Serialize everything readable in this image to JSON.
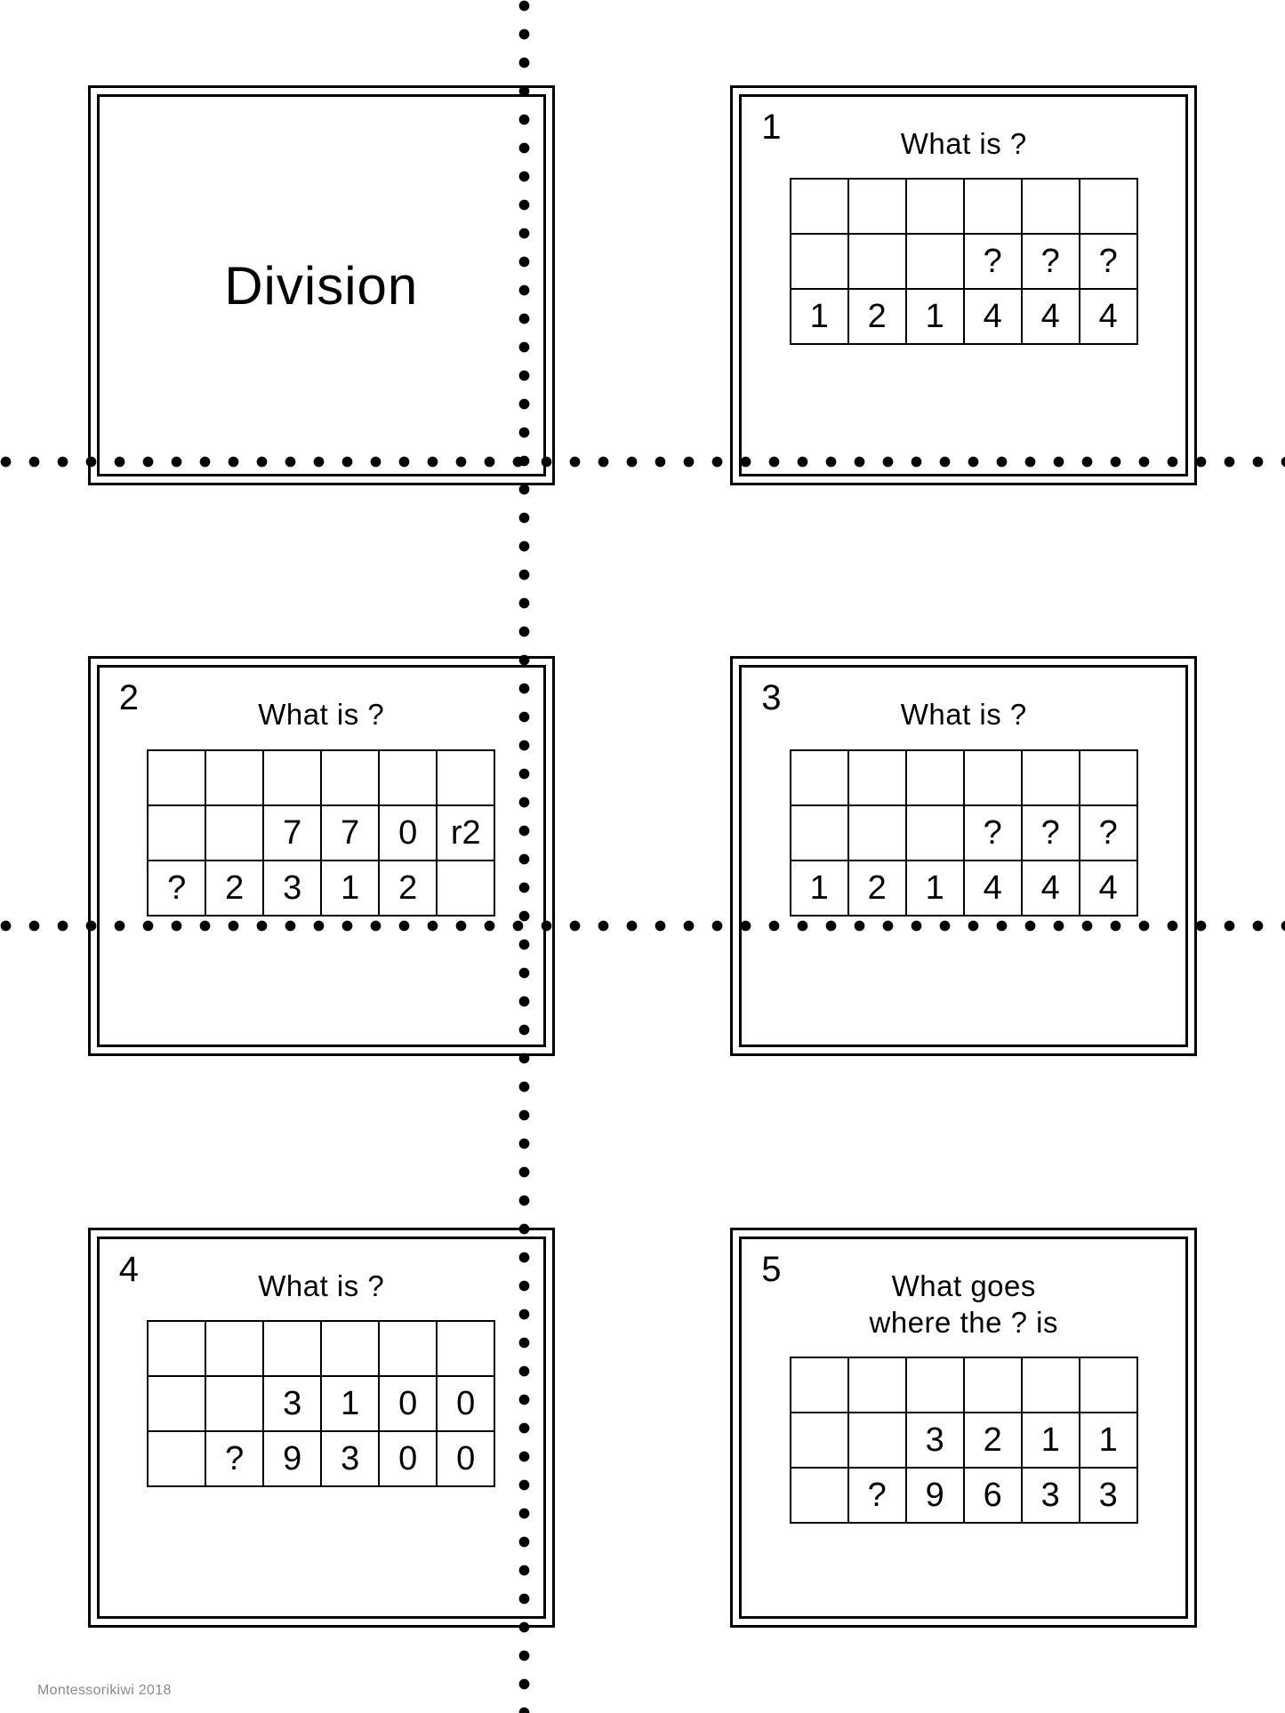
{
  "deck": {
    "title": "Division",
    "credit": "Montessorikiwi 2018"
  },
  "colors": {
    "units": "#1a7a1a",
    "tens": "#1a1aa8",
    "hundreds": "#d01414",
    "thousands": "#1a7a1a",
    "ink": "#000000",
    "credit": "#8a8a8a"
  },
  "prompts": {
    "what_is": "What is ?",
    "what_goes": "What goes\nwhere the ? is"
  },
  "cards": [
    {
      "number": "1",
      "prompt": "What is ?",
      "rows": [
        [
          {
            "text": "",
            "color": "black"
          },
          {
            "text": "",
            "color": "black"
          },
          {
            "text": "",
            "color": "black"
          },
          {
            "text": "",
            "color": "black"
          },
          {
            "text": "",
            "color": "black"
          },
          {
            "text": "",
            "color": "black"
          }
        ],
        [
          {
            "text": "",
            "color": "black"
          },
          {
            "text": "",
            "color": "black"
          },
          {
            "text": "",
            "color": "black"
          },
          {
            "text": "?",
            "color": "red"
          },
          {
            "text": "?",
            "color": "blue"
          },
          {
            "text": "?",
            "color": "green"
          }
        ],
        [
          {
            "text": "1",
            "color": "blue"
          },
          {
            "text": "2",
            "color": "green"
          },
          {
            "text": "1",
            "color": "green"
          },
          {
            "text": "4",
            "color": "red"
          },
          {
            "text": "4",
            "color": "blue"
          },
          {
            "text": "4",
            "color": "green"
          }
        ]
      ],
      "bracket": {
        "col": 2,
        "row": 2
      }
    },
    {
      "number": "2",
      "prompt": "What is ?",
      "rows": [
        [
          {
            "text": "",
            "color": "black"
          },
          {
            "text": "",
            "color": "black"
          },
          {
            "text": "",
            "color": "black"
          },
          {
            "text": "",
            "color": "black"
          },
          {
            "text": "",
            "color": "black"
          },
          {
            "text": "",
            "color": "black"
          }
        ],
        [
          {
            "text": "",
            "color": "black"
          },
          {
            "text": "",
            "color": "black"
          },
          {
            "text": "7",
            "color": "red"
          },
          {
            "text": "7",
            "color": "blue"
          },
          {
            "text": "0",
            "color": "green"
          },
          {
            "text": "r2",
            "color": "green"
          }
        ],
        [
          {
            "text": "?",
            "color": "green"
          },
          {
            "text": "2",
            "color": "green"
          },
          {
            "text": "3",
            "color": "red"
          },
          {
            "text": "1",
            "color": "blue"
          },
          {
            "text": "2",
            "color": "green"
          },
          {
            "text": "",
            "color": "black"
          }
        ]
      ],
      "bracket": {
        "col": 1,
        "row": 2
      }
    },
    {
      "number": "3",
      "prompt": "What is ?",
      "rows": [
        [
          {
            "text": "",
            "color": "black"
          },
          {
            "text": "",
            "color": "black"
          },
          {
            "text": "",
            "color": "black"
          },
          {
            "text": "",
            "color": "black"
          },
          {
            "text": "",
            "color": "black"
          },
          {
            "text": "",
            "color": "black"
          }
        ],
        [
          {
            "text": "",
            "color": "black"
          },
          {
            "text": "",
            "color": "black"
          },
          {
            "text": "",
            "color": "black"
          },
          {
            "text": "?",
            "color": "red"
          },
          {
            "text": "?",
            "color": "blue"
          },
          {
            "text": "?",
            "color": "green"
          }
        ],
        [
          {
            "text": "1",
            "color": "blue"
          },
          {
            "text": "2",
            "color": "green"
          },
          {
            "text": "1",
            "color": "green"
          },
          {
            "text": "4",
            "color": "red"
          },
          {
            "text": "4",
            "color": "blue"
          },
          {
            "text": "4",
            "color": "green"
          }
        ]
      ],
      "bracket": {
        "col": 2,
        "row": 2
      }
    },
    {
      "number": "4",
      "prompt": "What is ?",
      "rows": [
        [
          {
            "text": "",
            "color": "black"
          },
          {
            "text": "",
            "color": "black"
          },
          {
            "text": "",
            "color": "black"
          },
          {
            "text": "",
            "color": "black"
          },
          {
            "text": "",
            "color": "black"
          },
          {
            "text": "",
            "color": "black"
          }
        ],
        [
          {
            "text": "",
            "color": "black"
          },
          {
            "text": "",
            "color": "black"
          },
          {
            "text": "3",
            "color": "green"
          },
          {
            "text": "1",
            "color": "red"
          },
          {
            "text": "0",
            "color": "blue"
          },
          {
            "text": "0",
            "color": "green"
          }
        ],
        [
          {
            "text": "",
            "color": "black"
          },
          {
            "text": "?",
            "color": "green"
          },
          {
            "text": "9",
            "color": "green"
          },
          {
            "text": "3",
            "color": "red"
          },
          {
            "text": "0",
            "color": "blue"
          },
          {
            "text": "0",
            "color": "green"
          }
        ]
      ],
      "bracket": {
        "col": 2,
        "row": 2
      }
    },
    {
      "number": "5",
      "prompt": "What goes\nwhere the ? is",
      "rows": [
        [
          {
            "text": "",
            "color": "black"
          },
          {
            "text": "",
            "color": "black"
          },
          {
            "text": "",
            "color": "black"
          },
          {
            "text": "",
            "color": "black"
          },
          {
            "text": "",
            "color": "black"
          },
          {
            "text": "",
            "color": "black"
          }
        ],
        [
          {
            "text": "",
            "color": "black"
          },
          {
            "text": "",
            "color": "black"
          },
          {
            "text": "3",
            "color": "green"
          },
          {
            "text": "2",
            "color": "red"
          },
          {
            "text": "1",
            "color": "blue"
          },
          {
            "text": "1",
            "color": "green"
          }
        ],
        [
          {
            "text": "",
            "color": "black"
          },
          {
            "text": "?",
            "color": "green"
          },
          {
            "text": "9",
            "color": "green"
          },
          {
            "text": "6",
            "color": "red"
          },
          {
            "text": "3",
            "color": "blue"
          },
          {
            "text": "3",
            "color": "green"
          }
        ]
      ],
      "bracket": {
        "col": 2,
        "row": 2
      }
    }
  ]
}
